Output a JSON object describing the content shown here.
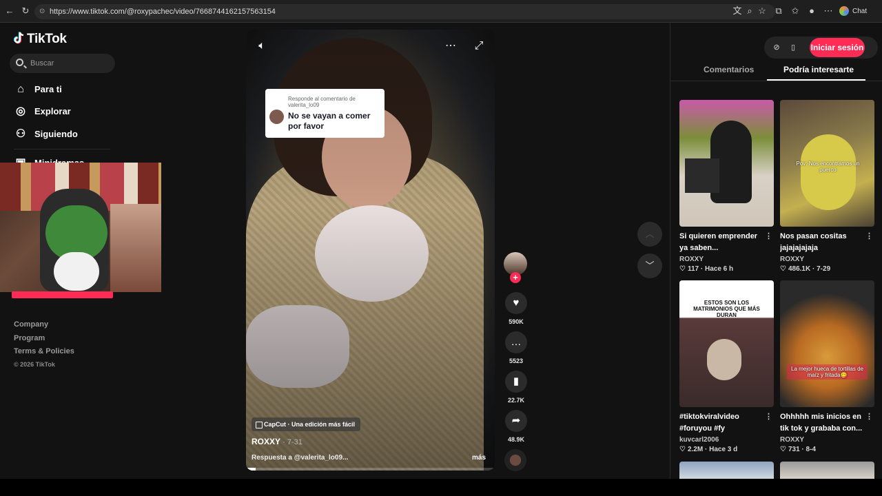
{
  "browser": {
    "url": "https://www.tiktok.com/@roxypachec/video/7668744162157563154",
    "chat_label": "Chat"
  },
  "sidebar": {
    "logo": "TikTok",
    "search_placeholder": "Buscar",
    "items": [
      {
        "label": "Para ti",
        "icon": "home-icon"
      },
      {
        "label": "Explorar",
        "icon": "compass-icon"
      },
      {
        "label": "Siguiendo",
        "icon": "user-follow-icon"
      },
      {
        "label": "Minidramas",
        "icon": "tv-icon"
      }
    ],
    "footer": {
      "links": [
        "Company",
        "Program",
        "Terms & Policies"
      ],
      "copyright": "© 2026 TikTok"
    }
  },
  "video": {
    "reply_header": "Responde al comentario de valerita_lo09",
    "reply_text": "No se vayan a comer por favor",
    "capcut_label": "CapCut · Una edición más fácil",
    "author": "ROXXY",
    "date": "· 7-31",
    "description": "Respuesta a @valerita_lo09...",
    "more": "más",
    "progress_fraction": 0.04
  },
  "actions": {
    "likes": "590K",
    "comments": "5523",
    "saves": "22.7K",
    "shares": "48.9K"
  },
  "right_panel": {
    "login_label": "Iniciar sesión",
    "tabs": [
      "Comentarios",
      "Podría interesarte"
    ],
    "active_tab": "Podría interesarte",
    "cards": [
      {
        "title": "Si quieren emprender ya saben...",
        "author": "ROXXY",
        "likes": "117",
        "time": "Hace 6 h",
        "overlay": ""
      },
      {
        "title": "Nos pasan cositas jajajajajaja",
        "author": "ROXXY",
        "likes": "486.1K",
        "time": "7-29",
        "overlay": "Pov: Nos encontramos un puerco"
      },
      {
        "title": "#tiktokviralvideo #foruyou #fy",
        "author": "kuvcarl2006",
        "likes": "2.2M",
        "time": "Hace 3 d",
        "overlay": "ESTOS SON LOS MATRIMONIOS QUE MÁS DURAN"
      },
      {
        "title": "Ohhhhh mis inicios en tik tok y grababa con...",
        "author": "ROXXY",
        "likes": "731",
        "time": "8-4",
        "overlay": "La mejor hueca de tortillas de maíz y fritada😋"
      }
    ]
  },
  "colors": {
    "accent": "#fe2c55",
    "background": "#121212"
  }
}
